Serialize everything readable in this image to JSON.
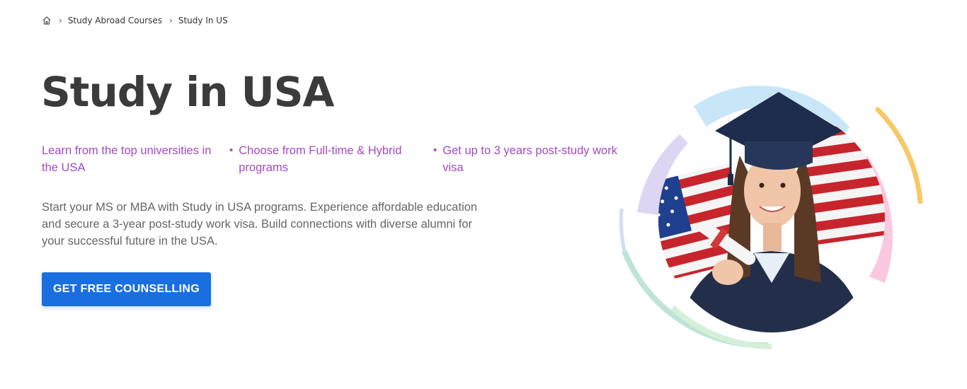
{
  "breadcrumb": {
    "home_icon": "home-icon",
    "separator_icon": "chevron-right-icon",
    "items": [
      {
        "label": "Study Abroad Courses"
      },
      {
        "label": "Study In US"
      }
    ]
  },
  "hero": {
    "title": "Study in USA",
    "highlights": [
      {
        "text": "Learn from the top universities in the USA"
      },
      {
        "text": "Choose from Full-time & Hybrid programs"
      },
      {
        "text": "Get up to 3 years post-study work visa"
      }
    ],
    "description": "Start your MS or MBA with Study in USA programs. Experience affordable education and secure a 3-year post-study work visa. Build connections with diverse alumni for your successful future in the USA.",
    "cta_label": "GET FREE COUNSELLING"
  },
  "colors": {
    "accent_purple": "#a24bc1",
    "cta_blue": "#1a6fe0",
    "title_gray": "#3b3b3b"
  }
}
